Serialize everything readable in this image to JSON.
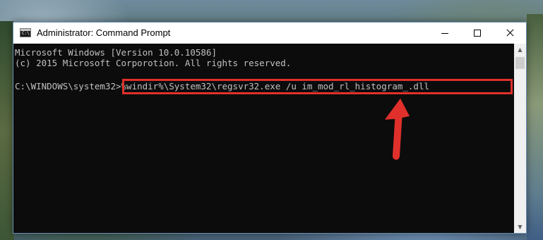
{
  "window": {
    "title": "Administrator: Command Prompt",
    "app_icon_text": "C:\\"
  },
  "console": {
    "line1": "Microsoft Windows [Version 10.0.10586]",
    "line2": "(c) 2015 Microsoft Corporotion. All rights reserved.",
    "prompt": "C:\\WINDOWS\\system32>",
    "command": "%windir%\\System32\\regsvr32.exe /u im_mod_rl_histogram_.dll"
  },
  "controls": {
    "minimize": "",
    "maximize": "",
    "close": ""
  },
  "scrollbar": {
    "up": "▲",
    "down": "▼"
  },
  "colors": {
    "highlight": "#e0302b",
    "arrow": "#e0302b",
    "console_bg": "#0c0c0c",
    "console_text": "#c0c0c0"
  }
}
